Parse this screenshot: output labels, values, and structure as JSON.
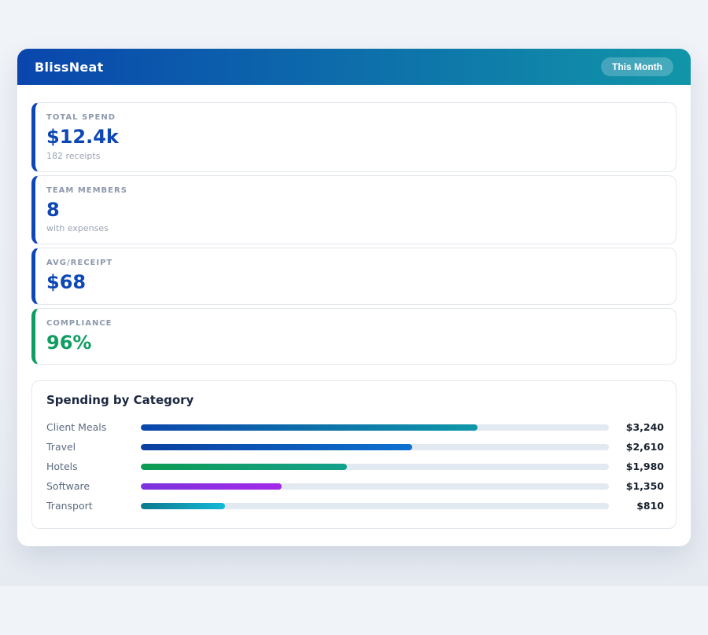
{
  "header": {
    "title": "BlissNeat",
    "badge": "This Month",
    "gradient_from": "#0a46ad",
    "gradient_to": "#1195a8"
  },
  "stats": [
    {
      "label": "TOTAL SPEND",
      "value": "$12.4k",
      "subtitle": "182 receipts",
      "accent": "#0d47b5",
      "value_color": "#0d47b5"
    },
    {
      "label": "TEAM MEMBERS",
      "value": "8",
      "subtitle": "with expenses",
      "accent": "#0d47b5",
      "value_color": "#0d47b5"
    },
    {
      "label": "AVG/RECEIPT",
      "value": "$68",
      "subtitle": "",
      "accent": "#0d47b5",
      "value_color": "#0d47b5"
    },
    {
      "label": "COMPLIANCE",
      "value": "96%",
      "subtitle": "",
      "accent": "#0f9d62",
      "value_color": "#0f9d62"
    }
  ],
  "chart": {
    "title": "Spending by Category",
    "rows": [
      {
        "label": "Client Meals",
        "value": "$3,240",
        "pct": 72,
        "color_from": "#0b46ad",
        "color_to": "#0f98a8"
      },
      {
        "label": "Travel",
        "value": "$2,610",
        "pct": 58,
        "color_from": "#0b3f9f",
        "color_to": "#0e72cf"
      },
      {
        "label": "Hotels",
        "value": "$1,980",
        "pct": 44,
        "color_from": "#0d9b52",
        "color_to": "#14a18c"
      },
      {
        "label": "Software",
        "value": "$1,350",
        "pct": 30,
        "color_from": "#7b33dd",
        "color_to": "#a32ae8"
      },
      {
        "label": "Transport",
        "value": "$810",
        "pct": 18,
        "color_from": "#0d7a8e",
        "color_to": "#13b9d8"
      }
    ]
  },
  "chart_data": {
    "type": "bar",
    "orientation": "horizontal",
    "title": "Spending by Category",
    "categories": [
      "Client Meals",
      "Travel",
      "Hotels",
      "Software",
      "Transport"
    ],
    "values": [
      3240,
      2610,
      1980,
      1350,
      810
    ],
    "value_labels": [
      "$3,240",
      "$2,610",
      "$1,980",
      "$1,350",
      "$810"
    ],
    "xlim": [
      0,
      4500
    ],
    "grid": false,
    "legend": false
  }
}
